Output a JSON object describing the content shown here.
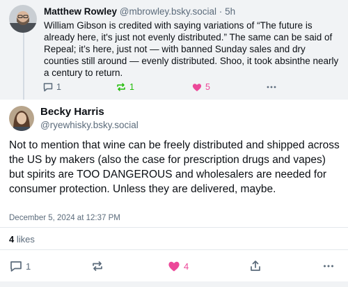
{
  "parent_post": {
    "author_name": "Matthew Rowley",
    "author_handle": "@mbrowley.bsky.social",
    "separator": "·",
    "time": "5h",
    "text": "William Gibson is credited with saying variations of “The future is already here, it's just not evenly distributed.” The same can be said of Repeal; it’s here, just not — with banned Sunday sales and dry counties still around — evenly distributed. Shoo, it took absinthe nearly a century to return.",
    "reply_count": "1",
    "repost_count": "1",
    "like_count": "5"
  },
  "main_post": {
    "author_name": "Becky Harris",
    "author_handle": "@ryewhisky.bsky.social",
    "text": "Not to mention that wine can be freely distributed and shipped across the US by makers (also the case for prescription drugs and vapes) but spirits are TOO DANGEROUS and wholesalers are needed for consumer protection. Unless they are delivered, maybe.",
    "timestamp": "December 5, 2024 at 12:37 PM",
    "likes_count": "4",
    "likes_label": "likes",
    "reply_count": "1",
    "like_count": "4"
  },
  "icons": {
    "reply": "reply-bubble-icon",
    "repost": "repost-arrows-icon",
    "like": "heart-icon",
    "share": "share-upload-icon",
    "more": "more-dots-icon"
  },
  "colors": {
    "repost_active": "#20bc07",
    "like_active": "#ec4899",
    "muted": "#5b6b7b",
    "parent_bg": "#f1f3f5"
  }
}
